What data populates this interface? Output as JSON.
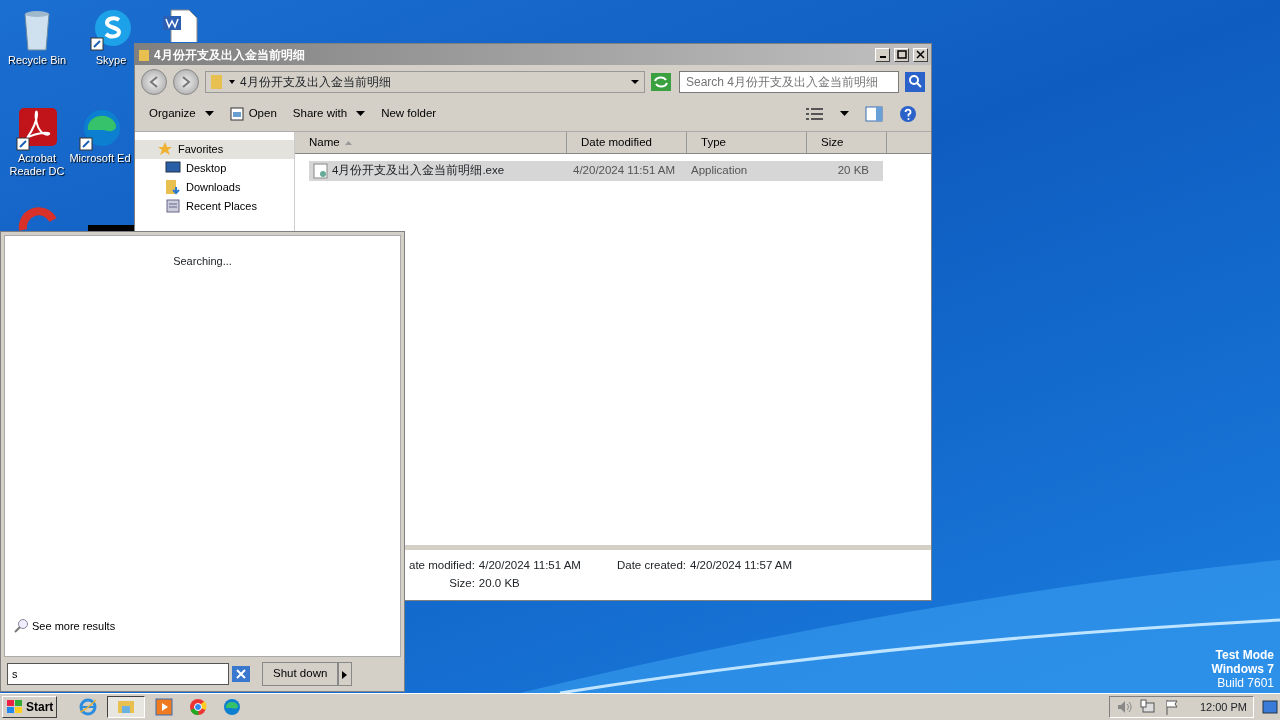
{
  "desktop_icons": [
    {
      "kind": "recycle",
      "label": "Recycle Bin"
    },
    {
      "kind": "skype",
      "label": "Skype"
    },
    {
      "kind": "word"
    },
    {
      "kind": "acrobat",
      "label": "Acrobat\nReader DC"
    },
    {
      "kind": "edge",
      "label": "Microsoft Ed"
    },
    {
      "kind": "ccleaner"
    }
  ],
  "explorer": {
    "title": "4月份开支及出入金当前明细",
    "address": "4月份开支及出入金当前明细",
    "search": {
      "placeholder": "Search 4月份开支及出入金当前明细"
    },
    "toolbar": [
      {
        "label": "Organize",
        "dropdown": true
      },
      {
        "label": "Open",
        "dropdown": false,
        "kind": "open"
      },
      {
        "label": "Share with",
        "dropdown": true
      },
      {
        "label": "New folder",
        "dropdown": false
      }
    ],
    "nav": [
      {
        "label": "Favorites",
        "kind": "star",
        "selected": true
      },
      {
        "label": "Desktop",
        "kind": "desktop",
        "selected": false
      },
      {
        "label": "Downloads",
        "kind": "downloads",
        "selected": false
      },
      {
        "label": "Recent Places",
        "kind": "recent",
        "selected": false
      }
    ],
    "columns": [
      {
        "label": "Name",
        "sorted": true
      },
      {
        "label": "Date modified",
        "sorted": false
      },
      {
        "label": "Type",
        "sorted": false
      },
      {
        "label": "Size",
        "sorted": false
      }
    ],
    "files": [
      {
        "name": "4月份开支及出入金当前明细.exe",
        "date": "4/20/2024 11:51 AM",
        "type": "Application",
        "size": "20 KB",
        "selected": true
      }
    ],
    "details": [
      {
        "label": "ate modified:",
        "value": "4/20/2024 11:51 AM"
      },
      {
        "label": "Date created:",
        "value": "4/20/2024 11:57 AM"
      },
      {
        "label": "Size:",
        "value": "20.0 KB"
      }
    ]
  },
  "start_menu": {
    "status": "Searching...",
    "see_more": "See more results",
    "search_value": "s",
    "shutdown": "Shut down"
  },
  "taskbar": {
    "start": "Start",
    "apps": [
      {
        "kind": "ie",
        "active": false
      },
      {
        "kind": "explorer",
        "active": true
      },
      {
        "kind": "media",
        "active": false
      },
      {
        "kind": "chrome",
        "active": false
      },
      {
        "kind": "edge",
        "active": false
      }
    ],
    "clock": "12:00 PM"
  },
  "os_notice": [
    "Test Mode",
    "Windows 7",
    "Build 7601"
  ]
}
